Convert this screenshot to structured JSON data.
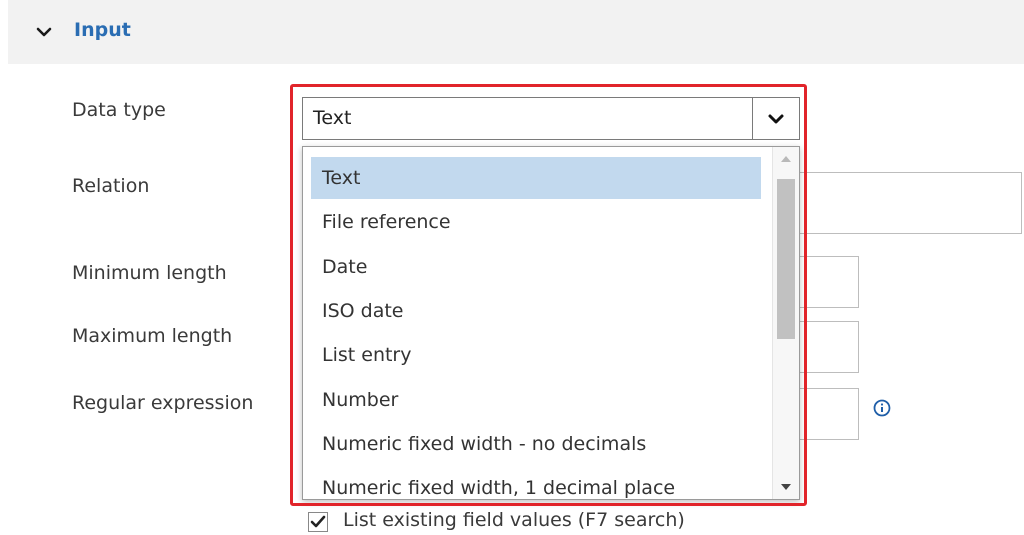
{
  "section": {
    "title": "Input"
  },
  "labels": {
    "data_type": "Data type",
    "relation": "Relation",
    "minimum_length": "Minimum length",
    "maximum_length": "Maximum length",
    "regular_expression": "Regular expression"
  },
  "select": {
    "value": "Text",
    "options": [
      "Text",
      "File reference",
      "Date",
      "ISO date",
      "List entry",
      "Number",
      "Numeric fixed width - no decimals",
      "Numeric fixed width, 1 decimal place"
    ],
    "selected_index": 0
  },
  "checkbox": {
    "label": "List existing field values (F7 search)",
    "checked": true
  },
  "colors": {
    "section_title": "#2a6db3",
    "highlight_border": "#e1242a",
    "selected_option_bg": "#c2d9ee"
  }
}
